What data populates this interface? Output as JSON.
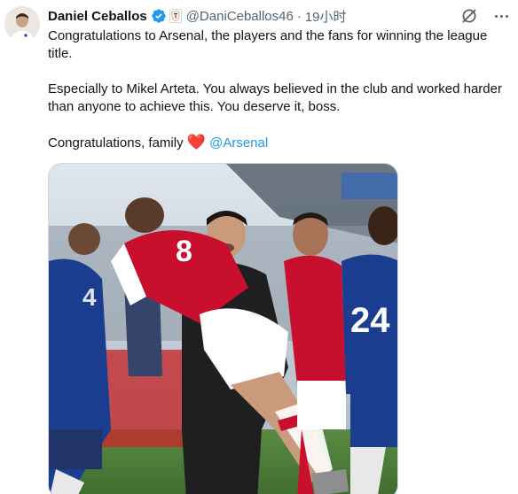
{
  "author": {
    "display_name": "Daniel Ceballos",
    "handle": "@DaniCeballos46",
    "separator": "·",
    "time": "19小时"
  },
  "icons": {
    "verified": "verified-badge-icon",
    "affiliate": "club-crest-icon",
    "grok": "grok-icon",
    "more": "more-icon"
  },
  "tweet": {
    "line1": "Congratulations to Arsenal, the players and the fans for winning the league title.",
    "line2": "Especially to Mikel Arteta. You always believed in the club and worked harder than anyone to achieve this. You deserve it, boss.",
    "line3_prefix": "Congratulations, family ",
    "line3_emoji": "❤️",
    "line3_mention": "@Arsenal"
  },
  "media": {
    "jersey_number_left": "8",
    "jersey_number_right": "24"
  },
  "colors": {
    "link": "#1d9bf0",
    "verified": "#1d9bf0",
    "secondary_text": "#536471",
    "arsenal_red": "#c8102e",
    "chelsea_blue": "#1a3d8f"
  }
}
